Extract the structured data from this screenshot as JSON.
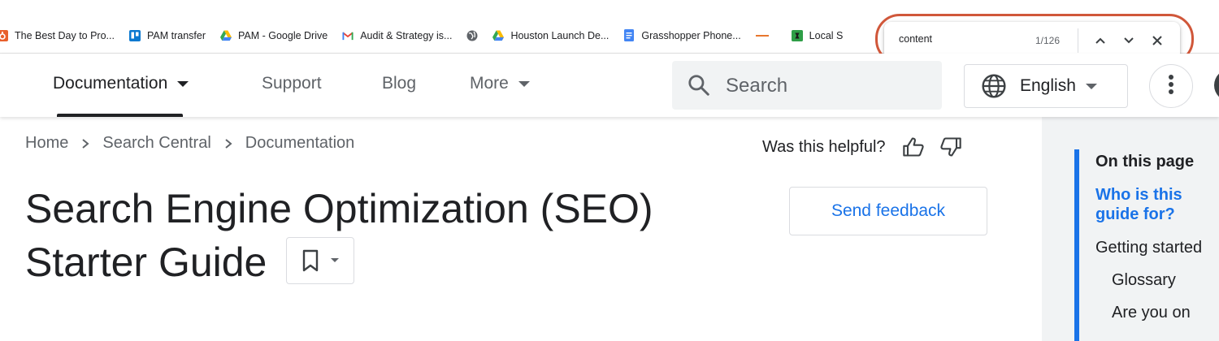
{
  "bookmarks": [
    {
      "label": "The Best Day to Pro...",
      "icon": "orange-logo-icon"
    },
    {
      "label": "PAM transfer",
      "icon": "trello-icon"
    },
    {
      "label": "PAM - Google Drive",
      "icon": "google-drive-icon"
    },
    {
      "label": "Audit & Strategy is...",
      "icon": "gmail-icon"
    },
    {
      "label": "",
      "icon": "globe-icon"
    },
    {
      "label": "Houston Launch De...",
      "icon": "google-drive-icon"
    },
    {
      "label": "Grasshopper Phone...",
      "icon": "google-docs-icon"
    },
    {
      "label": "",
      "icon": "dash-icon"
    },
    {
      "label": "Local S",
      "icon": "green-logo-icon"
    }
  ],
  "find": {
    "query": "content",
    "count": "1/126"
  },
  "nav": {
    "documentation": "Documentation",
    "support": "Support",
    "blog": "Blog",
    "more": "More",
    "search_placeholder": "Search",
    "language": "English"
  },
  "breadcrumb": [
    "Home",
    "Search Central",
    "Documentation"
  ],
  "helpful": "Was this helpful?",
  "page": {
    "title": "Search Engine Optimization (SEO) Starter Guide",
    "feedback": "Send feedback"
  },
  "toc": {
    "heading": "On this page",
    "items": [
      "Who is this guide for?",
      "Getting started",
      "Glossary",
      "Are you on"
    ]
  },
  "colors": {
    "accent": "#1a73e8",
    "highlight_ring": "#d0573a"
  }
}
